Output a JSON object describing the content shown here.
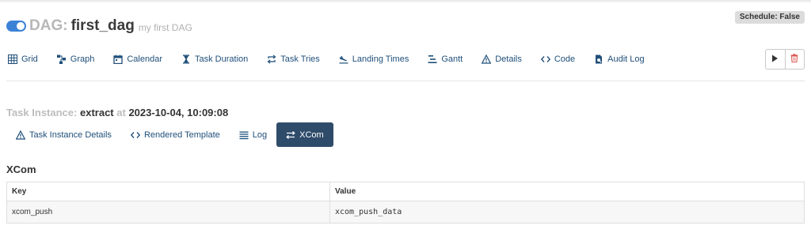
{
  "header": {
    "dag_label": "DAG:",
    "dag_id": "first_dag",
    "description": "my first DAG",
    "schedule_badge": "Schedule: False",
    "toggle_on": true,
    "accent": "#3b82d6"
  },
  "nav": [
    {
      "label": "Grid",
      "icon": "grid-icon"
    },
    {
      "label": "Graph",
      "icon": "graph-icon"
    },
    {
      "label": "Calendar",
      "icon": "calendar-icon"
    },
    {
      "label": "Task Duration",
      "icon": "hourglass-icon"
    },
    {
      "label": "Task Tries",
      "icon": "retry-arrows-icon"
    },
    {
      "label": "Landing Times",
      "icon": "plane-landing-icon"
    },
    {
      "label": "Gantt",
      "icon": "gantt-icon"
    },
    {
      "label": "Details",
      "icon": "warning-triangle-icon"
    },
    {
      "label": "Code",
      "icon": "code-icon"
    },
    {
      "label": "Audit Log",
      "icon": "audit-file-icon"
    }
  ],
  "actions": [
    {
      "name": "trigger-dag",
      "icon": "play-icon"
    },
    {
      "name": "delete-dag",
      "icon": "trash-icon",
      "color": "#d9534f"
    }
  ],
  "task_instance": {
    "label": "Task Instance:",
    "task_id": "extract",
    "at_label": "at",
    "timestamp": "2023-10-04, 10:09:08"
  },
  "tabs": [
    {
      "label": "Task Instance Details",
      "icon": "warning-triangle-icon",
      "active": false
    },
    {
      "label": "Rendered Template",
      "icon": "code-icon",
      "active": false
    },
    {
      "label": "Log",
      "icon": "list-lines-icon",
      "active": false
    },
    {
      "label": "XCom",
      "icon": "exchange-arrows-icon",
      "active": true
    }
  ],
  "xcom": {
    "title": "XCom",
    "columns": [
      "Key",
      "Value"
    ],
    "rows": [
      {
        "key": "xcom_push",
        "value": "xcom_push_data"
      }
    ]
  }
}
